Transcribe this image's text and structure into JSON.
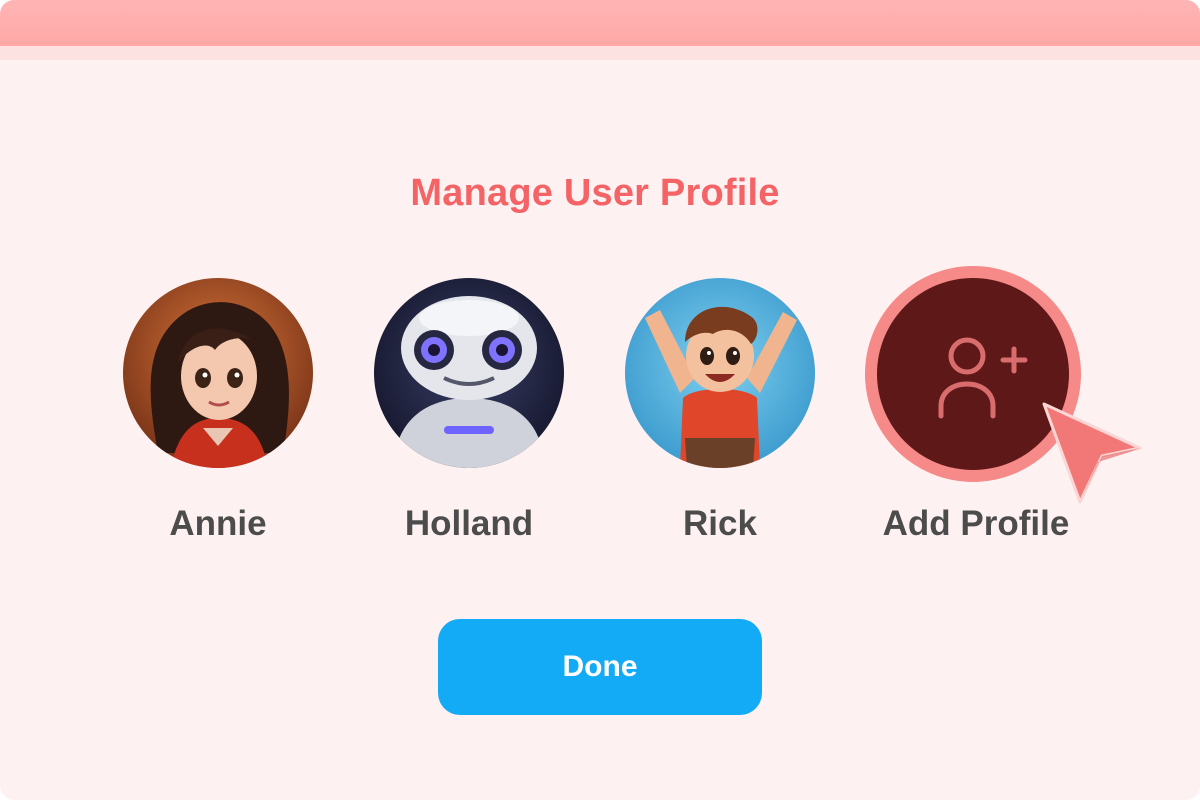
{
  "header": {
    "title": "Manage User Profile"
  },
  "profiles": [
    {
      "name": "Annie",
      "avatar": "girl-avatar"
    },
    {
      "name": "Holland",
      "avatar": "robot-avatar"
    },
    {
      "name": "Rick",
      "avatar": "boy-avatar"
    }
  ],
  "add_profile": {
    "label": "Add Profile",
    "icon": "add-user-icon"
  },
  "actions": {
    "done_label": "Done"
  },
  "colors": {
    "title_bar": "#fea8a7",
    "background": "#fdf1f1",
    "title_text": "#f46466",
    "add_ring": "#f58a88",
    "add_fill": "#5f1818",
    "done_button": "#14abf6"
  }
}
